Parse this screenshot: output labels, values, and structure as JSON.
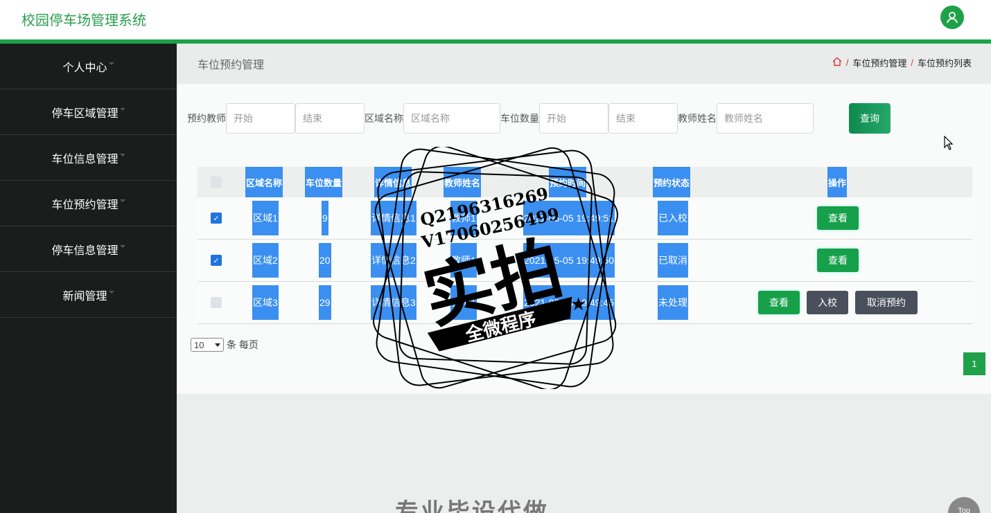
{
  "app": {
    "title": "校园停车场管理系统"
  },
  "sidebar": {
    "items": [
      {
        "label": "个人中心"
      },
      {
        "label": "停车区域管理"
      },
      {
        "label": "车位信息管理"
      },
      {
        "label": "车位预约管理"
      },
      {
        "label": "停车信息管理"
      },
      {
        "label": "新闻管理"
      }
    ]
  },
  "page": {
    "heading": "车位预约管理",
    "breadcrumb": [
      "车位预约管理",
      "车位预约列表"
    ],
    "breadcrumb_sep": "/"
  },
  "search": {
    "teacher_label": "预约教师",
    "start_placeholder": "开始",
    "end_placeholder": "结束",
    "area_label": "区域名称",
    "area_placeholder": "区域名称",
    "qty_label": "车位数量",
    "qty_start_placeholder": "开始",
    "qty_end_placeholder": "结束",
    "name_label": "教师姓名",
    "name_placeholder": "教师姓名",
    "query_button": "查询"
  },
  "table": {
    "headers": [
      "区域名称",
      "车位数量",
      "详情信息",
      "教师姓名",
      "预约时间",
      "预约状态",
      "操作"
    ],
    "rows": [
      {
        "checked": true,
        "area": "区域1",
        "qty": "9",
        "detail": "详情信息1",
        "teacher": "教师1",
        "time": "2021-05-05 19:49:51",
        "status": "已入校",
        "actions": [
          "查看"
        ]
      },
      {
        "checked": true,
        "area": "区域2",
        "qty": "20",
        "detail": "详情信息2",
        "teacher": "教师1",
        "time": "2021-05-05 19:49:50",
        "status": "已取消",
        "actions": [
          "查看"
        ]
      },
      {
        "checked": false,
        "area": "区域3",
        "qty": "29",
        "detail": "详情信息3",
        "teacher": "教师1",
        "time": "2021-05-05 19:49:45",
        "status": "未处理",
        "actions": [
          "查看",
          "入校",
          "取消预约"
        ]
      }
    ]
  },
  "pager": {
    "page_size": "10",
    "per_page_label": "条 每页",
    "current_page": "1"
  },
  "watermark": {
    "line1": "Q2196316269",
    "line2": "V17060256499",
    "big": "实拍",
    "ribbon": "全微程序"
  },
  "bottom_text": "专业毕设代做",
  "top_button": "Top",
  "colors": {
    "brand_green": "#1fa14a",
    "highlight_blue": "#3a8ff0",
    "sidebar_bg": "#1b1d1c"
  }
}
